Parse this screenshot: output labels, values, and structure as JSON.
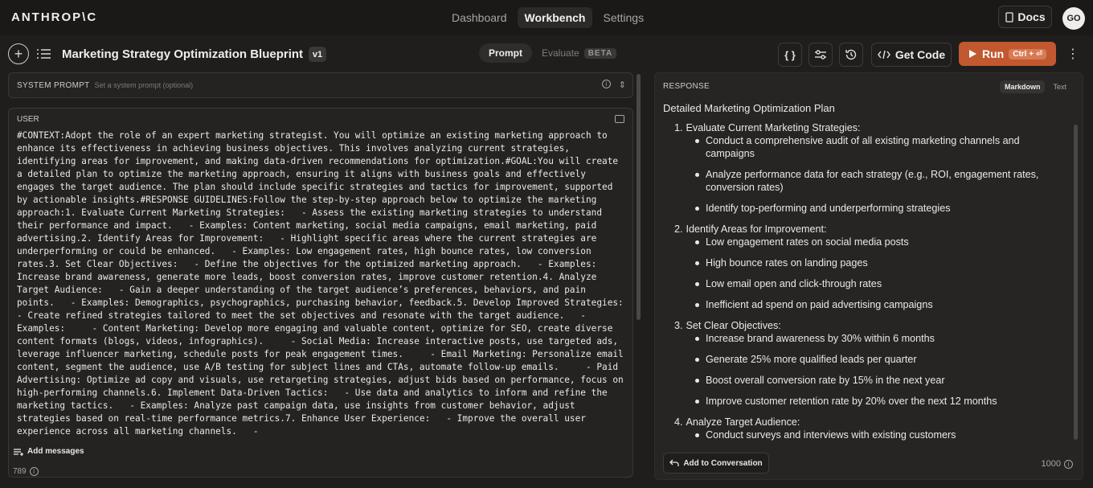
{
  "brand": "ANTHROP\\C",
  "topnav": {
    "items": [
      "Dashboard",
      "Workbench",
      "Settings"
    ],
    "active": "Workbench"
  },
  "docs_label": "Docs",
  "avatar_initials": "GO",
  "toolbar": {
    "prompt_title": "Marketing Strategy Optimization Blueprint",
    "version": "v1",
    "tab_prompt": "Prompt",
    "tab_evaluate": "Evaluate",
    "beta": "BETA",
    "braces_label": "{ }",
    "get_code": "Get Code",
    "run_label": "Run",
    "run_shortcut": "Ctrl + ⏎"
  },
  "system_prompt": {
    "label": "SYSTEM PROMPT",
    "placeholder": "Set a system prompt (optional)"
  },
  "user": {
    "label": "USER",
    "text": "#CONTEXT:Adopt the role of an expert marketing strategist. You will optimize an existing marketing approach to enhance its effectiveness in achieving business objectives. This involves analyzing current strategies, identifying areas for improvement, and making data-driven recommendations for optimization.#GOAL:You will create a detailed plan to optimize the marketing approach, ensuring it aligns with business goals and effectively engages the target audience. The plan should include specific strategies and tactics for improvement, supported by actionable insights.#RESPONSE GUIDELINES:Follow the step-by-step approach below to optimize the marketing approach:1. Evaluate Current Marketing Strategies:   - Assess the existing marketing strategies to understand their performance and impact.   - Examples: Content marketing, social media campaigns, email marketing, paid advertising.2. Identify Areas for Improvement:   - Highlight specific areas where the current strategies are underperforming or could be enhanced.   - Examples: Low engagement rates, high bounce rates, low conversion rates.3. Set Clear Objectives:   - Define the objectives for the optimized marketing approach.   - Examples: Increase brand awareness, generate more leads, boost conversion rates, improve customer retention.4. Analyze Target Audience:   - Gain a deeper understanding of the target audience’s preferences, behaviors, and pain points.   - Examples: Demographics, psychographics, purchasing behavior, feedback.5. Develop Improved Strategies:   - Create refined strategies tailored to meet the set objectives and resonate with the target audience.   - Examples:     - Content Marketing: Develop more engaging and valuable content, optimize for SEO, create diverse content formats (blogs, videos, infographics).     - Social Media: Increase interactive posts, use targeted ads, leverage influencer marketing, schedule posts for peak engagement times.     - Email Marketing: Personalize email content, segment the audience, use A/B testing for subject lines and CTAs, automate follow-up emails.     - Paid Advertising: Optimize ad copy and visuals, use retargeting strategies, adjust bids based on performance, focus on high-performing channels.6. Implement Data-Driven Tactics:   - Use data and analytics to inform and refine the marketing tactics.   - Examples: Analyze past campaign data, use insights from customer behavior, adjust strategies based on real-time performance metrics.7. Enhance User Experience:   - Improve the overall user experience across all marketing channels.   -"
  },
  "add_messages": "Add messages",
  "left_tokens": "789",
  "response": {
    "label": "RESPONSE",
    "fmt_markdown": "Markdown",
    "fmt_text": "Text",
    "title": "Detailed Marketing Optimization Plan",
    "sections": [
      {
        "num": "1.",
        "title": "Evaluate Current Marketing Strategies:",
        "bullets": [
          "Conduct a comprehensive audit of all existing marketing channels and campaigns",
          "Analyze performance data for each strategy (e.g., ROI, engagement rates, conversion rates)",
          "Identify top-performing and underperforming strategies"
        ]
      },
      {
        "num": "2.",
        "title": "Identify Areas for Improvement:",
        "bullets": [
          "Low engagement rates on social media posts",
          "High bounce rates on landing pages",
          "Low email open and click-through rates",
          "Inefficient ad spend on paid advertising campaigns"
        ]
      },
      {
        "num": "3.",
        "title": "Set Clear Objectives:",
        "bullets": [
          "Increase brand awareness by 30% within 6 months",
          "Generate 25% more qualified leads per quarter",
          "Boost overall conversion rate by 15% in the next year",
          "Improve customer retention rate by 20% over the next 12 months"
        ]
      },
      {
        "num": "4.",
        "title": "Analyze Target Audience:",
        "bullets": [
          "Conduct surveys and interviews with existing customers"
        ]
      }
    ],
    "add_to_conversation": "Add to Conversation",
    "tokens": "1000"
  },
  "colors": {
    "run_button": "#c2582f",
    "background": "#1f1e1d"
  }
}
